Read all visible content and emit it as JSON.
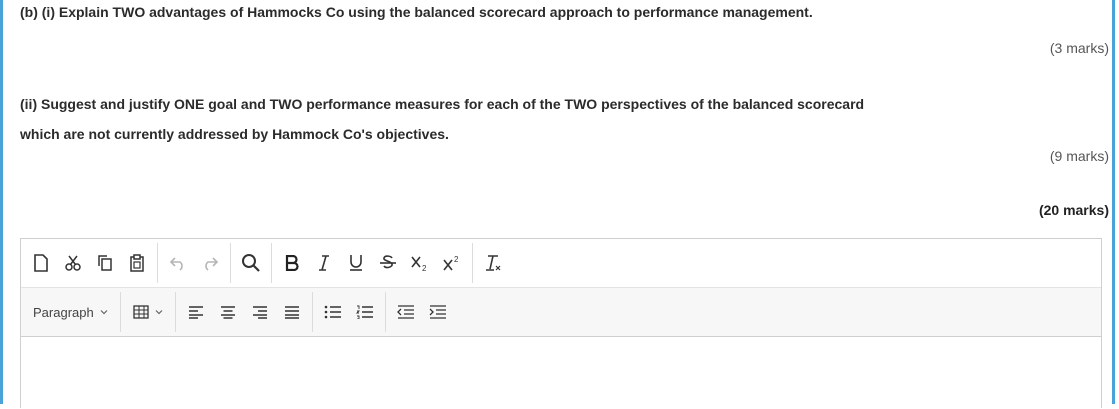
{
  "question": {
    "part_b_i": "(b) (i) Explain TWO advantages of Hammocks Co using the balanced scorecard approach to performance management.",
    "marks_b_i": "(3 marks)",
    "part_b_ii_line1": "(ii) Suggest and justify ONE goal and TWO performance measures for each of the TWO perspectives of the balanced scorecard",
    "part_b_ii_line2": "which are not currently addressed by Hammock Co's objectives.",
    "marks_b_ii": "(9 marks)",
    "total_marks": "(20 marks)"
  },
  "editor": {
    "toolbar_row1": [
      {
        "group": "file",
        "buttons": [
          "new-document-icon",
          "cut-icon",
          "copy-icon",
          "paste-icon"
        ]
      },
      {
        "group": "history",
        "buttons": [
          "undo-icon",
          "redo-icon"
        ]
      },
      {
        "group": "find",
        "buttons": [
          "search-icon"
        ]
      },
      {
        "group": "format",
        "buttons": [
          "bold-icon",
          "italic-icon",
          "underline-icon",
          "strikethrough-icon",
          "subscript-icon",
          "superscript-icon"
        ]
      },
      {
        "group": "clear",
        "buttons": [
          "clear-formatting-icon"
        ]
      }
    ],
    "paragraph_select": "Paragraph",
    "toolbar_row2": [
      "table-icon",
      "align-left-icon",
      "align-center-icon",
      "align-right-icon",
      "align-justify-icon",
      "bullet-list-icon",
      "numbered-list-icon",
      "outdent-icon",
      "indent-icon"
    ],
    "content": ""
  }
}
